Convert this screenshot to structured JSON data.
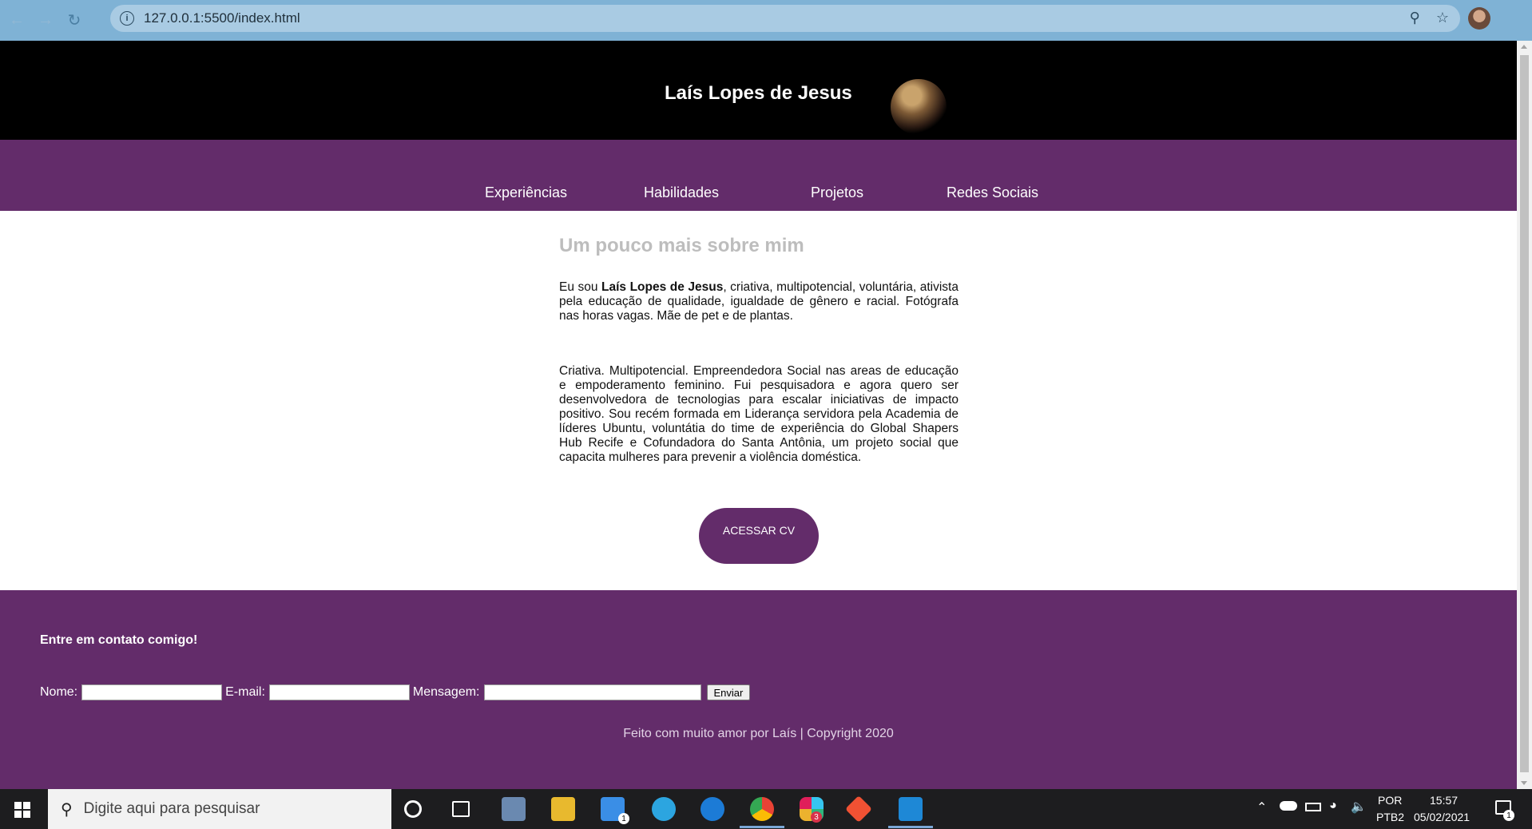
{
  "browser": {
    "url": "127.0.0.1:5500/index.html"
  },
  "page": {
    "header_title": "Laís Lopes de Jesus",
    "nav": [
      {
        "label": "Experiências"
      },
      {
        "label": "Habilidades"
      },
      {
        "label": "Projetos"
      },
      {
        "label": "Redes Sociais"
      }
    ],
    "about": {
      "title": "Um pouco mais sobre mim",
      "p1_prefix": "Eu sou ",
      "p1_name": "Laís Lopes de Jesus",
      "p1_suffix": ", criativa, multipotencial, voluntária, ativista pela educação de qualidade, igualdade de gênero e racial. Fotógrafa nas horas vagas. Mãe de pet e de plantas.",
      "p2": "Criativa. Multipotencial. Empreendedora Social nas areas de educação e empoderamento feminino. Fui pesquisadora e agora quero ser desenvolvedora de tecnologias para escalar iniciativas de impacto positivo. Sou recém formada em Liderança servidora pela Academia de líderes Ubuntu, voluntátia do time de experiência do Global Shapers Hub Recife e Cofundadora do Santa Antônia, um projeto social que capacita mulheres para prevenir a violência doméstica.",
      "cv_button": "ACESSAR CV"
    },
    "footer": {
      "contact_title": "Entre em contato comigo!",
      "name_label": "Nome:",
      "name_value": "",
      "email_label": "E-mail:",
      "email_value": "",
      "message_label": "Mensagem:",
      "message_value": "",
      "send_label": "Enviar",
      "copyright": "Feito com muito amor por Laís | Copyright 2020"
    }
  },
  "taskbar": {
    "search_placeholder": "Digite aqui para pesquisar",
    "lang_top": "POR",
    "lang_bottom": "PTB2",
    "time": "15:57",
    "date": "05/02/2021",
    "mail_badge": "1",
    "slack_badge": "3",
    "notifications_badge": "1"
  },
  "colors": {
    "accent": "#632c6a",
    "header_bg": "#000000",
    "about_title": "#bdbdbd"
  }
}
